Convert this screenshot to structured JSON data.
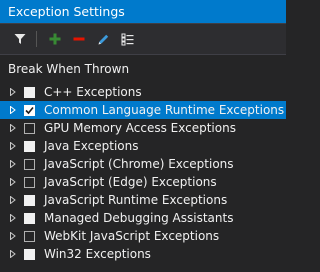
{
  "window": {
    "title": "Exception Settings"
  },
  "toolbar": {
    "buttons": [
      {
        "icon": "filter-icon"
      },
      {
        "icon": "add-icon",
        "color": "#388a34"
      },
      {
        "icon": "remove-icon",
        "color": "#e51400"
      },
      {
        "icon": "edit-icon"
      },
      {
        "icon": "restore-list-icon"
      }
    ]
  },
  "tree": {
    "header": "Break When Thrown",
    "items": [
      {
        "label": "C++ Exceptions",
        "state": "full",
        "selected": false
      },
      {
        "label": "Common Language Runtime Exceptions",
        "state": "checked",
        "selected": true
      },
      {
        "label": "GPU Memory Access Exceptions",
        "state": "empty",
        "selected": false
      },
      {
        "label": "Java Exceptions",
        "state": "full",
        "selected": false
      },
      {
        "label": "JavaScript (Chrome) Exceptions",
        "state": "empty",
        "selected": false
      },
      {
        "label": "JavaScript (Edge) Exceptions",
        "state": "empty",
        "selected": false
      },
      {
        "label": "JavaScript Runtime Exceptions",
        "state": "full",
        "selected": false
      },
      {
        "label": "Managed Debugging Assistants",
        "state": "full",
        "selected": false
      },
      {
        "label": "WebKit JavaScript Exceptions",
        "state": "empty",
        "selected": false
      },
      {
        "label": "Win32 Exceptions",
        "state": "full",
        "selected": false
      }
    ]
  },
  "colors": {
    "accent": "#007acc",
    "background": "#252526",
    "toolbar": "#2d2d30"
  }
}
